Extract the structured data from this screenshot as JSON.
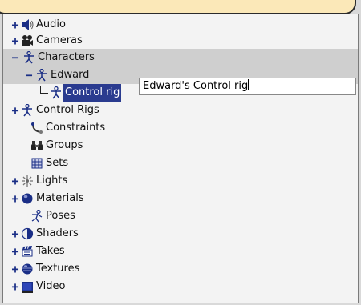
{
  "tree": {
    "items": [
      {
        "label": "Audio",
        "icon": "speaker-icon",
        "expander": "+"
      },
      {
        "label": "Cameras",
        "icon": "camera-icon",
        "expander": "+"
      },
      {
        "label": "Characters",
        "icon": "character-icon",
        "expander": "−"
      },
      {
        "label": "Edward",
        "icon": "character-icon",
        "expander": "−"
      },
      {
        "label": "Control rig",
        "icon": "character-icon",
        "expander": ""
      },
      {
        "label": "Control Rigs",
        "icon": "character-icon",
        "expander": "+"
      },
      {
        "label": "Constraints",
        "icon": "constraint-icon",
        "expander": ""
      },
      {
        "label": "Groups",
        "icon": "binoculars-icon",
        "expander": ""
      },
      {
        "label": "Sets",
        "icon": "sets-icon",
        "expander": ""
      },
      {
        "label": "Lights",
        "icon": "light-icon",
        "expander": "+"
      },
      {
        "label": "Materials",
        "icon": "material-sphere-icon",
        "expander": "+"
      },
      {
        "label": "Poses",
        "icon": "pose-icon",
        "expander": ""
      },
      {
        "label": "Shaders",
        "icon": "shader-icon",
        "expander": "+"
      },
      {
        "label": "Takes",
        "icon": "clapper-icon",
        "expander": "+"
      },
      {
        "label": "Textures",
        "icon": "texture-sphere-icon",
        "expander": "+"
      },
      {
        "label": "Video",
        "icon": "video-icon",
        "expander": "+"
      }
    ]
  },
  "rename": {
    "value": "Edward's Control rig"
  },
  "colors": {
    "expander": "#1a2e86",
    "selection": "#cfcfcf",
    "callout": "#fbe8b8"
  }
}
